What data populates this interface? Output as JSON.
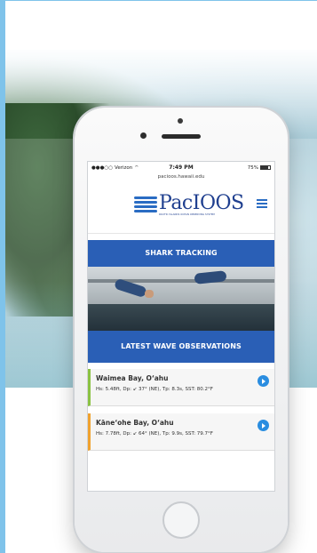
{
  "status_bar": {
    "carrier": "Verizon",
    "time": "7:49 PM",
    "battery": "75%"
  },
  "url": "pacioos.hawaii.edu",
  "logo": {
    "name": "PacIOOS",
    "subtitle": "PACIFIC ISLANDS OCEAN OBSERVING SYSTEM"
  },
  "shark_tracking": {
    "label": "SHARK TRACKING"
  },
  "wave_observations": {
    "label": "LATEST WAVE OBSERVATIONS",
    "items": [
      {
        "title": "Waimea Bay, O‘ahu",
        "detail": "Hs: 5.48ft, Dp: ↙ 37° (NE), Tp: 8.3s, SST: 80.2°F",
        "accent": "#8ac243"
      },
      {
        "title": "Kāne‘ohe Bay, O‘ahu",
        "detail": "Hs: 7.78ft, Dp: ↙ 64° (NE), Tp: 9.9s, SST: 79.7°F",
        "accent": "#f0a22f"
      }
    ]
  },
  "colors": {
    "brand_blue": "#2a5fb6",
    "play_blue": "#2a8de0",
    "frame_border": "#7fc3ea"
  }
}
